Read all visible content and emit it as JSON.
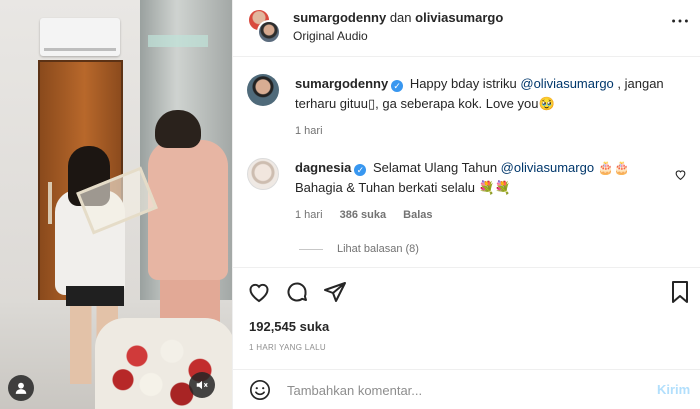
{
  "header": {
    "user1": "sumargodenny",
    "conjunction": "dan",
    "user2": "oliviasumargo",
    "audio": "Original Audio",
    "more_icon": "more-horizontal-icon"
  },
  "comments": [
    {
      "username": "sumargodenny",
      "verified": true,
      "text_before": "Happy bday istriku ",
      "mention": "@oliviasumargo",
      "text_after": " , jangan terharu gituu▯, ga seberapa kok. Love you🥹",
      "time": "1 hari"
    },
    {
      "username": "dagnesia",
      "verified": true,
      "text_before": "Selamat Ulang Tahun ",
      "mention": "@oliviasumargo",
      "text_after": " 🎂🎂 Bahagia & Tuhan berkati selalu 💐💐",
      "time": "1 hari",
      "likes": "386 suka",
      "reply": "Balas",
      "view_replies": "Lihat balasan (8)"
    }
  ],
  "post": {
    "likes": "192,545 suka",
    "date": "1 HARI YANG LALU"
  },
  "add_comment": {
    "placeholder": "Tambahkan komentar...",
    "post_label": "Kirim"
  },
  "colors": {
    "link": "#00376b",
    "verified": "#3897f0",
    "muted": "#737373",
    "post_disabled": "#b2dffc"
  }
}
